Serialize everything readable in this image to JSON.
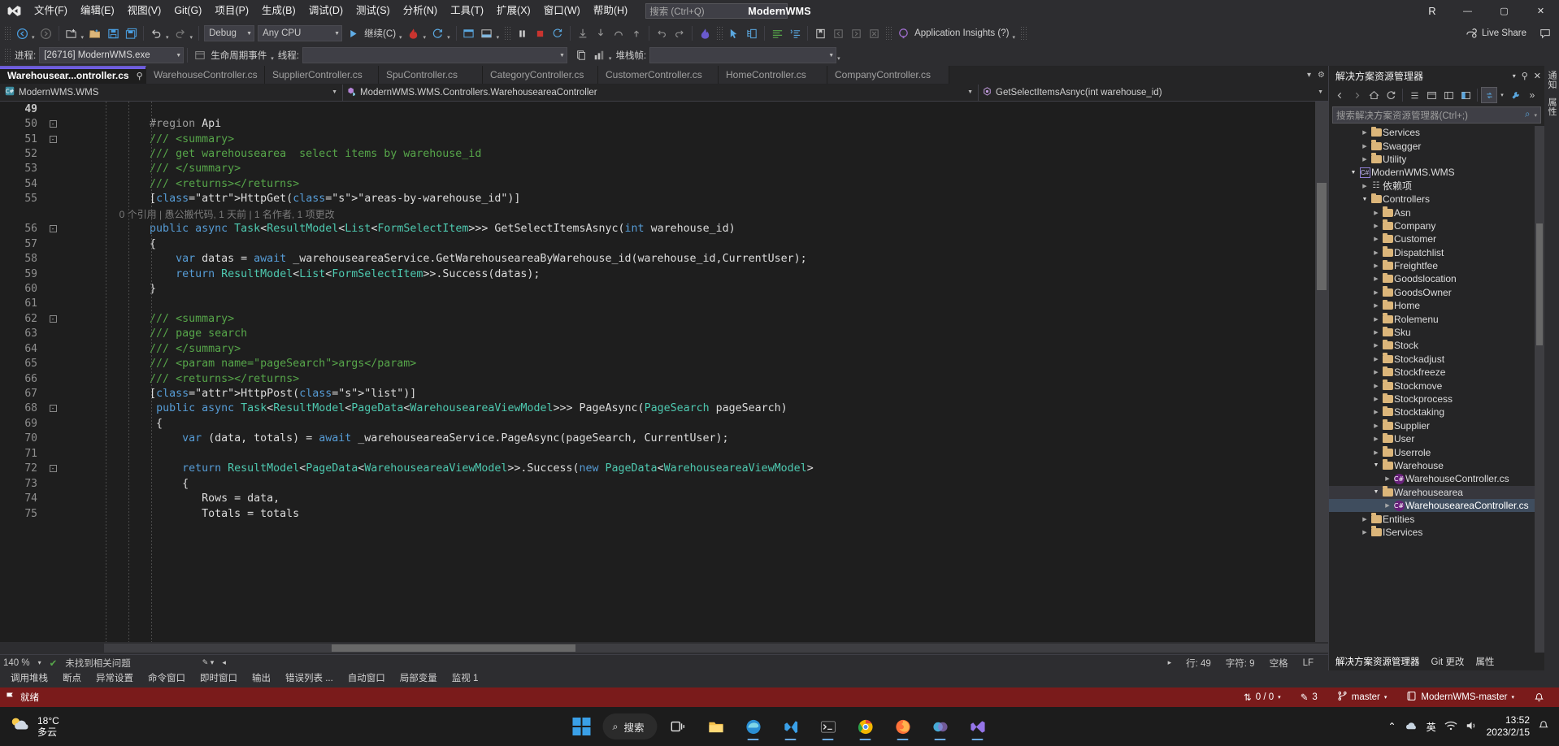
{
  "titlebar": {
    "menu": [
      "文件(F)",
      "编辑(E)",
      "视图(V)",
      "Git(G)",
      "项目(P)",
      "生成(B)",
      "调试(D)",
      "测试(S)",
      "分析(N)",
      "工具(T)",
      "扩展(X)",
      "窗口(W)",
      "帮助(H)"
    ],
    "search_placeholder": "搜索 (Ctrl+Q)",
    "app_title": "ModernWMS",
    "account_initial": "R",
    "minimize": "—",
    "maximize": "▢",
    "close": "✕"
  },
  "toolbar": {
    "debug_config": "Debug",
    "platform": "Any CPU",
    "continue_label": "继续(C)",
    "app_insights": "Application Insights (?)",
    "live_share": "Live Share"
  },
  "processbar": {
    "process_label": "进程:",
    "process_value": "[26716] ModernWMS.exe",
    "lifecycle_label": "生命周期事件",
    "thread_label": "线程:",
    "thread_value": "",
    "stackframe_label": "堆栈帧:"
  },
  "tabs": [
    {
      "label": "Warehousear...ontroller.cs",
      "active": true
    },
    {
      "label": "WarehouseController.cs",
      "active": false
    },
    {
      "label": "SupplierController.cs",
      "active": false
    },
    {
      "label": "SpuController.cs",
      "active": false
    },
    {
      "label": "CategoryController.cs",
      "active": false
    },
    {
      "label": "CustomerController.cs",
      "active": false
    },
    {
      "label": "HomeController.cs",
      "active": false
    },
    {
      "label": "CompanyController.cs",
      "active": false
    }
  ],
  "navbar": {
    "project": "ModernWMS.WMS",
    "type": "ModernWMS.WMS.Controllers.WarehouseareaController",
    "member": "GetSelectItemsAsnyc(int warehouse_id)"
  },
  "code": {
    "lines": [
      {
        "n": "49",
        "fold": "",
        "text": ""
      },
      {
        "n": "50",
        "fold": "-",
        "text": "        #region Api"
      },
      {
        "n": "51",
        "fold": "-",
        "text": "        /// <summary>"
      },
      {
        "n": "52",
        "fold": "",
        "text": "        /// get warehousearea  select items by warehouse_id"
      },
      {
        "n": "53",
        "fold": "",
        "text": "        /// </summary>"
      },
      {
        "n": "54",
        "fold": "",
        "text": "        /// <returns></returns>"
      },
      {
        "n": "55",
        "fold": "",
        "text": "        [HttpGet(\"areas-by-warehouse_id\")]"
      },
      {
        "n": "",
        "fold": "",
        "text": "        0 个引用 | 愚公搬代码, 1 天前 | 1 名作者, 1 项更改",
        "codelens": true
      },
      {
        "n": "56",
        "fold": "-",
        "text": "        public async Task<ResultModel<List<FormSelectItem>>> GetSelectItemsAsnyc(int warehouse_id)"
      },
      {
        "n": "57",
        "fold": "",
        "text": "        {"
      },
      {
        "n": "58",
        "fold": "",
        "text": "            var datas = await _warehouseareaService.GetWarehouseareaByWarehouse_id(warehouse_id,CurrentUser);"
      },
      {
        "n": "59",
        "fold": "",
        "text": "            return ResultModel<List<FormSelectItem>>.Success(datas);"
      },
      {
        "n": "60",
        "fold": "",
        "text": "        }"
      },
      {
        "n": "61",
        "fold": "",
        "text": ""
      },
      {
        "n": "62",
        "fold": "-",
        "text": "        /// <summary>"
      },
      {
        "n": "63",
        "fold": "",
        "text": "        /// page search"
      },
      {
        "n": "64",
        "fold": "",
        "text": "        /// </summary>"
      },
      {
        "n": "65",
        "fold": "",
        "text": "        /// <param name=\"pageSearch\">args</param>"
      },
      {
        "n": "66",
        "fold": "",
        "text": "        /// <returns></returns>"
      },
      {
        "n": "67",
        "fold": "",
        "text": "        [HttpPost(\"list\")]"
      },
      {
        "n": "68",
        "fold": "-",
        "text": "         public async Task<ResultModel<PageData<WarehouseareaViewModel>>> PageAsync(PageSearch pageSearch)"
      },
      {
        "n": "69",
        "fold": "",
        "text": "         {"
      },
      {
        "n": "70",
        "fold": "",
        "text": "             var (data, totals) = await _warehouseareaService.PageAsync(pageSearch, CurrentUser);"
      },
      {
        "n": "71",
        "fold": "",
        "text": ""
      },
      {
        "n": "72",
        "fold": "-",
        "text": "             return ResultModel<PageData<WarehouseareaViewModel>>.Success(new PageData<WarehouseareaViewModel>"
      },
      {
        "n": "73",
        "fold": "",
        "text": "             {"
      },
      {
        "n": "74",
        "fold": "",
        "text": "                Rows = data,"
      },
      {
        "n": "75",
        "fold": "",
        "text": "                Totals = totals"
      }
    ]
  },
  "editor_status": {
    "zoom": "140 %",
    "issues": "未找到相关问题",
    "line_label": "行: 49",
    "col_label": "字符: 9",
    "spaces": "空格",
    "eol": "LF"
  },
  "solution_explorer": {
    "title": "解决方案资源管理器",
    "search_placeholder": "搜索解决方案资源管理器(Ctrl+;)",
    "tree": [
      {
        "indent": 2,
        "arrow": "▶",
        "icon": "folder",
        "label": "Services"
      },
      {
        "indent": 2,
        "arrow": "▶",
        "icon": "folder",
        "label": "Swagger"
      },
      {
        "indent": 2,
        "arrow": "▶",
        "icon": "folder",
        "label": "Utility"
      },
      {
        "indent": 1,
        "arrow": "▲",
        "icon": "project",
        "label": "ModernWMS.WMS"
      },
      {
        "indent": 2,
        "arrow": "▶",
        "icon": "dep",
        "label": "依赖项"
      },
      {
        "indent": 2,
        "arrow": "▲",
        "icon": "folder",
        "label": "Controllers"
      },
      {
        "indent": 3,
        "arrow": "▶",
        "icon": "folder",
        "label": "Asn"
      },
      {
        "indent": 3,
        "arrow": "▶",
        "icon": "folder",
        "label": "Company"
      },
      {
        "indent": 3,
        "arrow": "▶",
        "icon": "folder",
        "label": "Customer"
      },
      {
        "indent": 3,
        "arrow": "▶",
        "icon": "folder",
        "label": "Dispatchlist"
      },
      {
        "indent": 3,
        "arrow": "▶",
        "icon": "folder",
        "label": "Freightfee"
      },
      {
        "indent": 3,
        "arrow": "▶",
        "icon": "folder",
        "label": "Goodslocation"
      },
      {
        "indent": 3,
        "arrow": "▶",
        "icon": "folder",
        "label": "GoodsOwner"
      },
      {
        "indent": 3,
        "arrow": "▶",
        "icon": "folder",
        "label": "Home"
      },
      {
        "indent": 3,
        "arrow": "▶",
        "icon": "folder",
        "label": "Rolemenu"
      },
      {
        "indent": 3,
        "arrow": "▶",
        "icon": "folder",
        "label": "Sku"
      },
      {
        "indent": 3,
        "arrow": "▶",
        "icon": "folder",
        "label": "Stock"
      },
      {
        "indent": 3,
        "arrow": "▶",
        "icon": "folder",
        "label": "Stockadjust"
      },
      {
        "indent": 3,
        "arrow": "▶",
        "icon": "folder",
        "label": "Stockfreeze"
      },
      {
        "indent": 3,
        "arrow": "▶",
        "icon": "folder",
        "label": "Stockmove"
      },
      {
        "indent": 3,
        "arrow": "▶",
        "icon": "folder",
        "label": "Stockprocess"
      },
      {
        "indent": 3,
        "arrow": "▶",
        "icon": "folder",
        "label": "Stocktaking"
      },
      {
        "indent": 3,
        "arrow": "▶",
        "icon": "folder",
        "label": "Supplier"
      },
      {
        "indent": 3,
        "arrow": "▶",
        "icon": "folder",
        "label": "User"
      },
      {
        "indent": 3,
        "arrow": "▶",
        "icon": "folder",
        "label": "Userrole"
      },
      {
        "indent": 3,
        "arrow": "▲",
        "icon": "folder",
        "label": "Warehouse"
      },
      {
        "indent": 4,
        "arrow": "▶",
        "icon": "cs",
        "label": "WarehouseController.cs"
      },
      {
        "indent": 3,
        "arrow": "▲",
        "icon": "folder",
        "label": "Warehousearea",
        "hover": true
      },
      {
        "indent": 4,
        "arrow": "▶",
        "icon": "cs",
        "label": "WarehouseareaController.cs",
        "selected": true
      },
      {
        "indent": 2,
        "arrow": "▶",
        "icon": "folder",
        "label": "Entities"
      },
      {
        "indent": 2,
        "arrow": "▶",
        "icon": "folder",
        "label": "IServices"
      }
    ],
    "footer_tabs": [
      "解决方案资源管理器",
      "Git 更改",
      "属性"
    ],
    "rail_tabs": [
      "通知",
      "属性"
    ]
  },
  "panel_tabs": [
    "调用堆栈",
    "断点",
    "异常设置",
    "命令窗口",
    "即时窗口",
    "输出",
    "错误列表 ...",
    "自动窗口",
    "局部变量",
    "监视 1"
  ],
  "vs_status": {
    "ready": "就绪",
    "updown": "0 / 0",
    "errors": "3",
    "branch": "master",
    "repo": "ModernWMS-master"
  },
  "taskbar": {
    "weather_temp": "18°C",
    "weather_desc": "多云",
    "search_label": "搜索",
    "ime_lang": "英",
    "time": "13:52",
    "date": "2023/2/15",
    "apps": [
      "file-explorer-icon",
      "folder-icon",
      "edge-icon",
      "vscode-icon",
      "terminal-icon",
      "chrome-icon",
      "firefox-icon",
      "circles-icon",
      "vs-icon"
    ]
  },
  "colors": {
    "accent_tab": "#7160e8",
    "status_bar": "#7a1b1b",
    "cs_purple": "#68217a",
    "folder_gold": "#dcb67a"
  }
}
